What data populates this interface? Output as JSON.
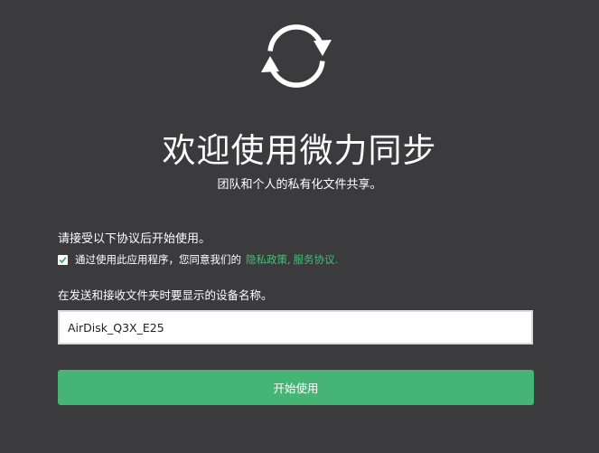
{
  "header": {
    "logo_icon": "sync-circle-arrows-icon",
    "title": "欢迎使用微力同步",
    "subtitle": "团队和个人的私有化文件共享。"
  },
  "agreement": {
    "heading": "请接受以下协议后开始使用。",
    "checked": true,
    "consent_text": "通过使用此应用程序，您同意我们的",
    "privacy_link": "隐私政策",
    "separator": ",",
    "terms_link": "服务协议",
    "trailing": "."
  },
  "device": {
    "label": "在发送和接收文件夹时要显示的设备名称。",
    "value": "AirDisk_Q3X_E25"
  },
  "actions": {
    "start_label": "开始使用"
  },
  "colors": {
    "background": "#3b3b3d",
    "accent": "#46b474",
    "link": "#4cba78"
  }
}
